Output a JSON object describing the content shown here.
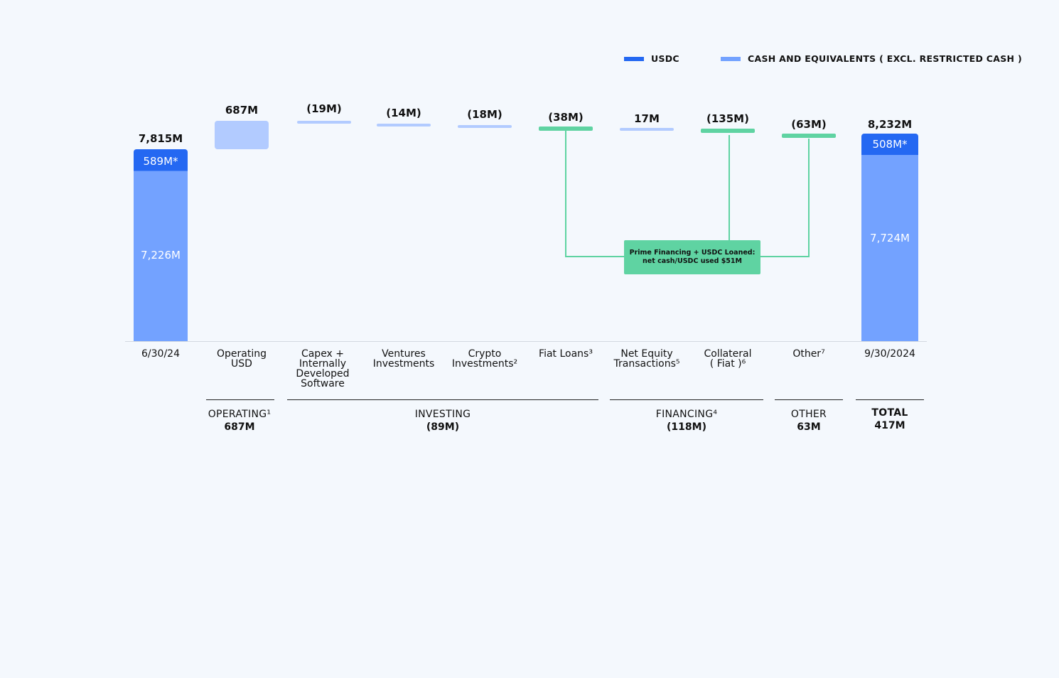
{
  "legend": {
    "usdc": "USDC",
    "cash": "CASH AND EQUIVALENTS ( EXCL. RESTRICTED CASH )"
  },
  "colors": {
    "usdc": "#2468f2",
    "cash": "#73a2ff",
    "change": "#b2cbff",
    "financing": "#5fd3a2"
  },
  "chart_data": {
    "type": "waterfall",
    "unit": "M",
    "start": {
      "category": "6/30/24",
      "total": 7815,
      "total_label": "7,815M",
      "usdc": 589,
      "usdc_label": "589M*",
      "cash": 7226,
      "cash_label": "7,226M"
    },
    "steps": [
      {
        "category": "Operating\nUSD",
        "value": 687,
        "label": "687M",
        "group": "operating"
      },
      {
        "category": "Capex +\nInternally\nDeveloped\nSoftware",
        "value": -19,
        "label": "(19M)",
        "group": "investing"
      },
      {
        "category": "Ventures\nInvestments",
        "value": -14,
        "label": "(14M)",
        "group": "investing"
      },
      {
        "category": "Crypto\nInvestments²",
        "value": -18,
        "label": "(18M)",
        "group": "investing"
      },
      {
        "category": "Fiat Loans³",
        "value": -38,
        "label": "(38M)",
        "group": "financing",
        "highlight": true
      },
      {
        "category": "Net Equity\nTransactions⁵",
        "value": 17,
        "label": "17M",
        "group": "financing"
      },
      {
        "category": "Collateral\n( Fiat )⁶",
        "value": -135,
        "label": "(135M)",
        "group": "financing",
        "highlight": true
      },
      {
        "category": "Other⁷",
        "value": -63,
        "label": "(63M)",
        "group": "other",
        "highlight": true
      }
    ],
    "end": {
      "category": "9/30/2024",
      "total": 8232,
      "total_label": "8,232M",
      "usdc": 508,
      "usdc_label": "508M*",
      "cash": 7724,
      "cash_label": "7,724M"
    },
    "groups": [
      {
        "name": "OPERATING¹",
        "value": "687M"
      },
      {
        "name": "INVESTING",
        "value": "(89M)"
      },
      {
        "name": "FINANCING⁴",
        "value": "(118M)"
      },
      {
        "name": "OTHER",
        "value": "63M"
      },
      {
        "name": "TOTAL",
        "value": "417M"
      }
    ],
    "annotation": {
      "line1": "Prime Financing + USDC Loaned:",
      "line2": "net cash/USDC used $51M"
    }
  }
}
